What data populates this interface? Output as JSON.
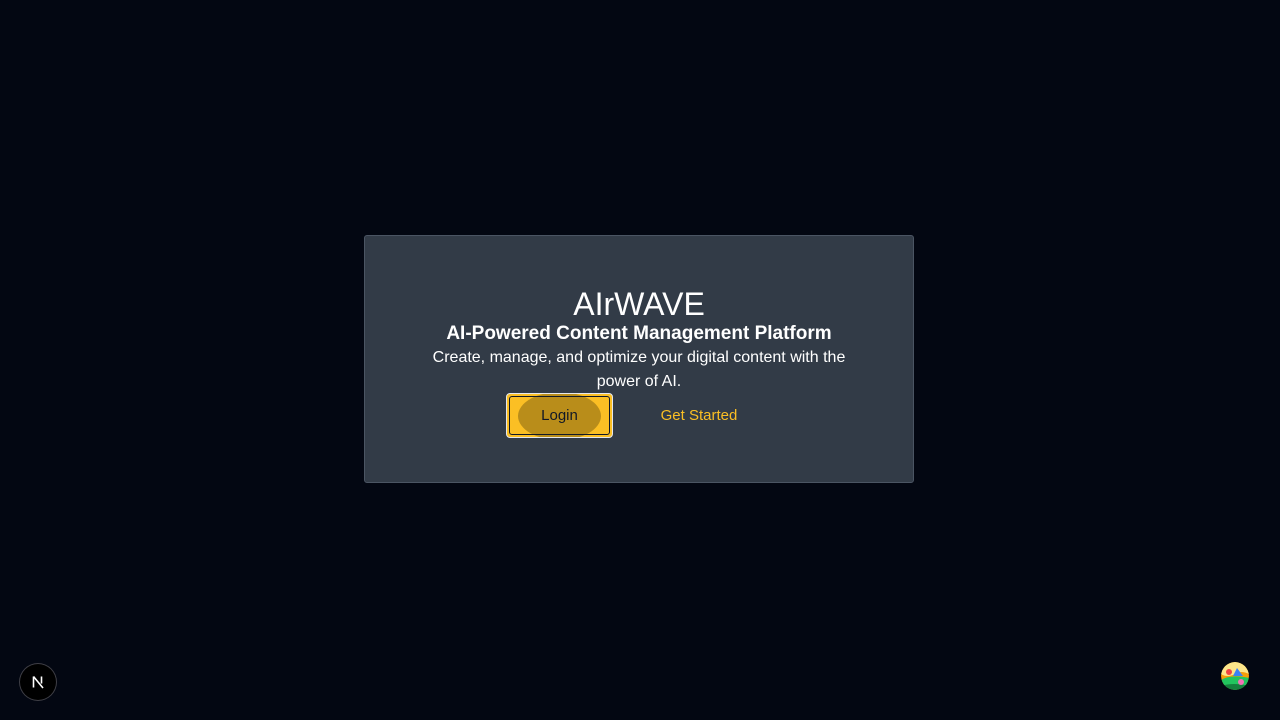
{
  "hero": {
    "title": "AIrWAVE",
    "subtitle": "AI-Powered Content Management Platform",
    "description": "Create, manage, and optimize your digital content with the power of AI."
  },
  "actions": {
    "login_label": "Login",
    "get_started_label": "Get Started"
  },
  "colors": {
    "background": "#030712",
    "card": "#323b47",
    "accent": "#fbbf24"
  },
  "icons": {
    "dev_badge": "nextjs-logo-icon",
    "avatar": "avatar-icon"
  }
}
